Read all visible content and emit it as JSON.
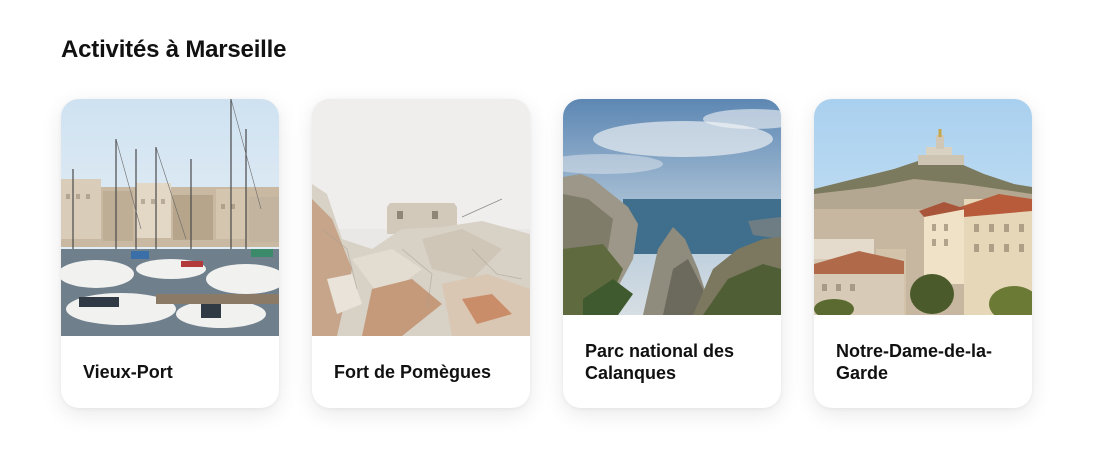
{
  "section": {
    "title": "Activités à Marseille"
  },
  "cards": [
    {
      "title": "Vieux-Port",
      "image": "harbor-sailboats-photo"
    },
    {
      "title": "Fort de Pomègues",
      "image": "stone-fort-on-rocks-photo"
    },
    {
      "title": "Parc national des Calanques",
      "image": "limestone-cliffs-sea-photo"
    },
    {
      "title": "Notre-Dame-de-la-Garde",
      "image": "hilltop-basilica-city-photo"
    }
  ]
}
